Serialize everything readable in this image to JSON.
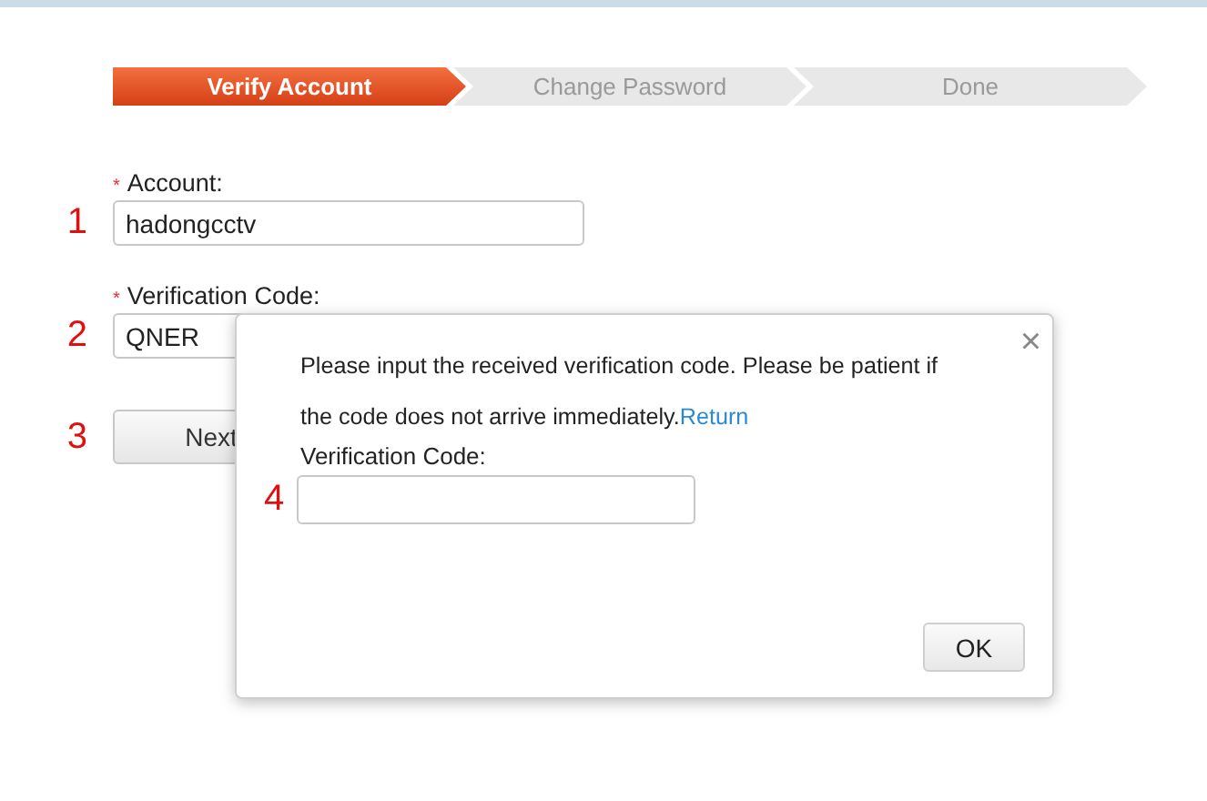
{
  "steps": [
    {
      "label": "Verify Account",
      "selected": true
    },
    {
      "label": "Change Password",
      "selected": false
    },
    {
      "label": "Done",
      "selected": false
    }
  ],
  "form": {
    "fields": [
      {
        "label": "Account:",
        "required": true,
        "value": "hadongcctv",
        "marker": "1"
      },
      {
        "label": "Verification Code:",
        "required": true,
        "value": "QNER",
        "marker": "2"
      }
    ],
    "required_mark": "*",
    "next_button": {
      "label": "Next",
      "marker": "3"
    }
  },
  "dialog": {
    "close": "×",
    "message": "Please input the received verification code. Please be patient if the code does not arrive immediately.",
    "link": "Return",
    "field_label": "Verification Code:",
    "field_marker": "4",
    "ok_button": "OK"
  }
}
